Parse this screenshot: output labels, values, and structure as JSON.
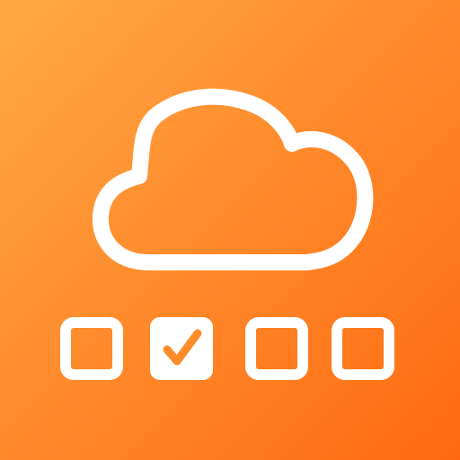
{
  "icon": {
    "cloud_icon": "cloud-icon",
    "checkbox_icon": "checkbox-icon",
    "checkmark_icon": "checkmark-icon"
  },
  "checkboxes": [
    {
      "checked": false
    },
    {
      "checked": true
    },
    {
      "checked": false
    },
    {
      "checked": false
    }
  ],
  "colors": {
    "gradient_start": "#FFA945",
    "gradient_end": "#FF6A10",
    "foreground": "#FFFFFF",
    "check_stroke": "#FF8C2A"
  }
}
